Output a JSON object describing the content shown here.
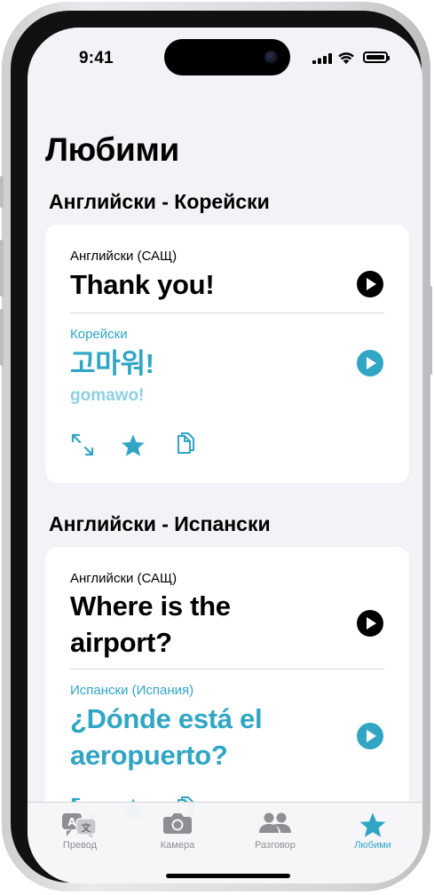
{
  "status": {
    "time": "9:41"
  },
  "page": {
    "title": "Любими"
  },
  "sections": [
    {
      "heading": "Английски - Корейски",
      "source_lang": "Английски (САЩ)",
      "source_text": "Thank you!",
      "target_lang": "Корейски",
      "target_text": "고마워!",
      "transliteration": "gomawo!"
    },
    {
      "heading": "Английски - Испански",
      "source_lang": "Английски (САЩ)",
      "source_line1": "Where is the",
      "source_line2": "airport?",
      "target_lang": "Испански (Испания)",
      "target_line1": "¿Dónde está el",
      "target_line2": "aeropuerto?"
    }
  ],
  "tabs": [
    {
      "label": "Превод",
      "icon": "translate-icon"
    },
    {
      "label": "Камера",
      "icon": "camera-icon"
    },
    {
      "label": "Разговор",
      "icon": "people-icon"
    },
    {
      "label": "Любими",
      "icon": "star-icon"
    }
  ],
  "colors": {
    "accent": "#30a6c4",
    "background": "#f2f2f7",
    "card": "#ffffff"
  }
}
